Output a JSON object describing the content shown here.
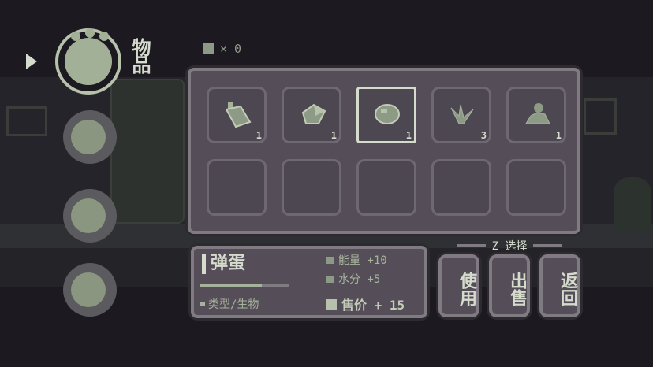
{
  "hud": {
    "currency_count": "× 0"
  },
  "categories": {
    "active_label": "物品",
    "items": [
      {
        "icon": "paw-icon"
      },
      {
        "icon": "fish-icon"
      },
      {
        "icon": "pad-icon"
      },
      {
        "icon": "pencil-icon"
      }
    ]
  },
  "inventory": {
    "slots": [
      {
        "icon": "bottle-icon",
        "qty": "1"
      },
      {
        "icon": "crystal-icon",
        "qty": "1"
      },
      {
        "icon": "egg-icon",
        "qty": "1",
        "selected": true
      },
      {
        "icon": "leaf-icon",
        "qty": "3"
      },
      {
        "icon": "rock-icon",
        "qty": "1"
      },
      {
        "icon": "",
        "qty": ""
      },
      {
        "icon": "",
        "qty": ""
      },
      {
        "icon": "",
        "qty": ""
      },
      {
        "icon": "",
        "qty": ""
      },
      {
        "icon": "",
        "qty": ""
      }
    ]
  },
  "details": {
    "name": "弹蛋",
    "type": "类型/生物",
    "energy": "能量 +10",
    "water": "水分 +5",
    "price": "售价 + 15"
  },
  "actions": {
    "select_hint": "Z 选择",
    "use": "使用",
    "sell": "出售",
    "back": "返回"
  },
  "colors": {
    "background": "#1c1a20",
    "panel": "#554e59",
    "panel_border": "#807a82",
    "highlight": "#d6dccd",
    "accent_green": "#a6b39c"
  }
}
